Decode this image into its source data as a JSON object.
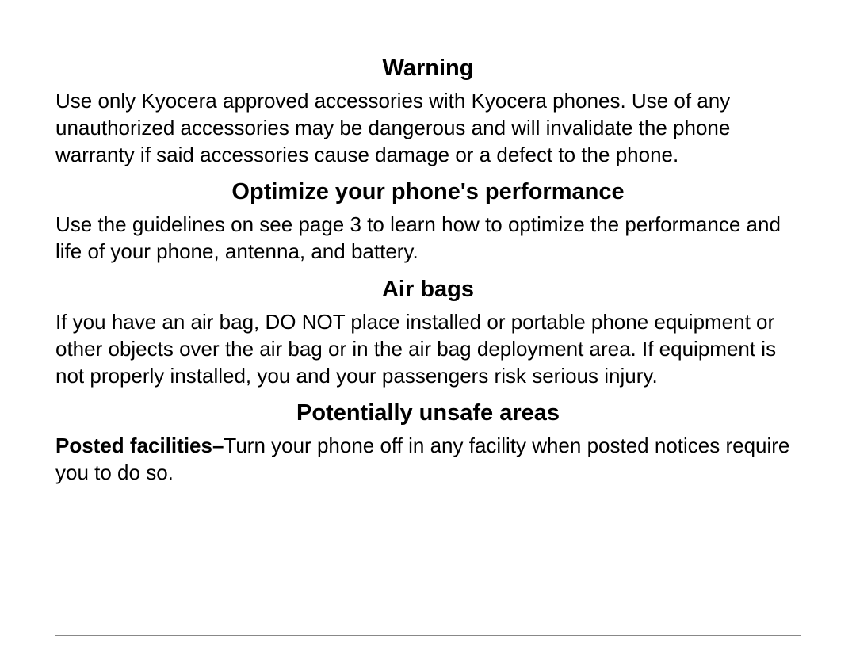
{
  "sections": {
    "warning": {
      "heading": "Warning",
      "body": "Use only Kyocera approved accessories with Kyocera phones. Use of any unauthorized accessories may be dangerous and will invalidate the phone warranty if said accessories cause damage or a defect to the phone."
    },
    "optimize": {
      "heading": "Optimize your phone's performance",
      "body": "Use the guidelines on see page 3 to learn how to optimize the performance and life of your phone, antenna, and battery."
    },
    "airbags": {
      "heading": "Air bags",
      "body": "If you have an air bag, DO NOT place installed or portable phone equipment or other objects over the air bag or in the air bag deployment area. If equipment is not properly installed, you and your passengers risk serious injury."
    },
    "unsafe": {
      "heading": "Potentially unsafe areas",
      "lead": "Posted facilities–",
      "body": "Turn your phone off in any facility when posted notices require you to do so."
    }
  }
}
